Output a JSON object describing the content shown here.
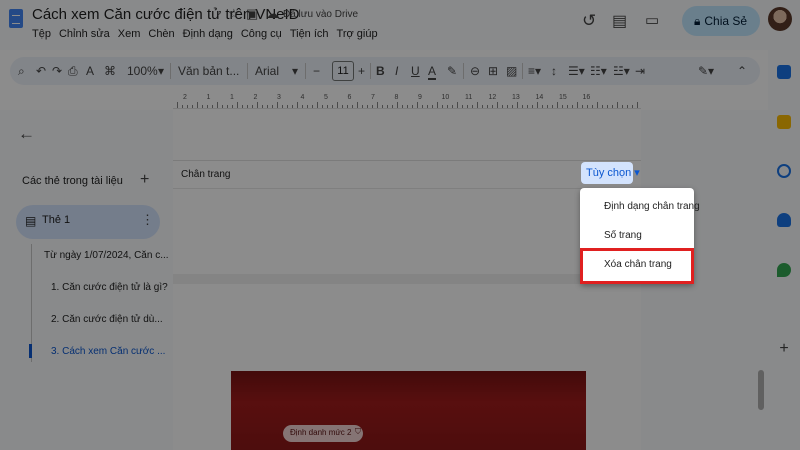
{
  "header": {
    "title": "Cách xem Căn cước điện tử trên VNeID",
    "saved_status": "Đã lưu vào Drive",
    "share_label": "Chia Sẻ"
  },
  "menu": [
    "Tệp",
    "Chỉnh sửa",
    "Xem",
    "Chèn",
    "Định dạng",
    "Công cụ",
    "Tiện ích",
    "Trợ giúp"
  ],
  "toolbar": {
    "zoom": "100%",
    "style": "Văn bản t...",
    "font": "Arial",
    "font_size": "11"
  },
  "ruler_numbers": [
    "2",
    "1",
    "1",
    "2",
    "3",
    "4",
    "5",
    "6",
    "7",
    "8",
    "9",
    "10",
    "11",
    "12",
    "13",
    "14",
    "15",
    "16"
  ],
  "sidebar": {
    "heading": "Các thẻ trong tài liệu",
    "tab_label": "Thẻ 1",
    "outline": [
      "Từ ngày 1/07/2024, Căn c...",
      "1. Căn cước điện tử là gì?",
      "2. Căn cước điện tử dù...",
      "3. Cách xem Căn cước ..."
    ]
  },
  "footer": {
    "label": "Chân trang",
    "options_label": "Tùy chọn ▾"
  },
  "context_menu": {
    "items": [
      "Định dạng chân trang",
      "Số trang",
      "Xóa chân trang"
    ],
    "highlighted_index": 2
  },
  "image": {
    "chip_label": "Định danh mức 2"
  },
  "colors": {
    "accent": "#0b57d0",
    "highlight_border": "#e02020",
    "share_bg": "#c2e7ff"
  }
}
